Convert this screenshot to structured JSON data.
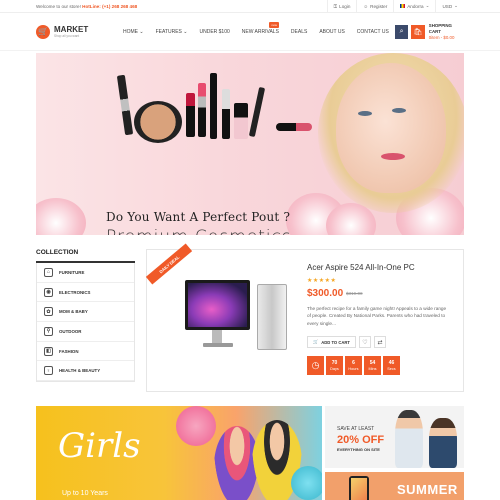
{
  "topbar": {
    "welcome": "Welcome to our store!",
    "hotline_label": "HotLine:",
    "hotline_number": "(+1) 268 268 468",
    "login": "Login",
    "register": "Register",
    "language": "Andorra",
    "currency": "USD"
  },
  "header": {
    "logo_name": "MARKET",
    "logo_tag": "Shop all you want",
    "nav": [
      {
        "label": "HOME",
        "dropdown": true
      },
      {
        "label": "FEATURES",
        "dropdown": true
      },
      {
        "label": "UNDER $100"
      },
      {
        "label": "NEW ARRIVALS",
        "badge": "new"
      },
      {
        "label": "DEALS"
      },
      {
        "label": "ABOUT US"
      },
      {
        "label": "CONTACT US"
      }
    ],
    "cart_title": "SHOPPING CART",
    "cart_summary": "0item - $0.00"
  },
  "banner": {
    "headline": "Do You Want A Perfect Pout ?",
    "subline": "Premium Cosmetics"
  },
  "collection": {
    "title": "COLLECTION",
    "items": [
      {
        "label": "FURNITURE",
        "icon": "chair-icon",
        "glyph": "⌂"
      },
      {
        "label": "ELECTRONICS",
        "icon": "speaker-icon",
        "glyph": "◉"
      },
      {
        "label": "MOM & BABY",
        "icon": "stroller-icon",
        "glyph": "✿"
      },
      {
        "label": "OUTDOOR",
        "icon": "bike-icon",
        "glyph": "⚲"
      },
      {
        "label": "FASHION",
        "icon": "bag-icon",
        "glyph": "◧"
      },
      {
        "label": "HEALTH & BEAUTY",
        "icon": "beauty-icon",
        "glyph": "♀"
      }
    ]
  },
  "deal": {
    "ribbon": "DAILY DEAL",
    "title": "Acer Aspire 524 All-In-One PC",
    "rating_stars": "★★★★★",
    "rating": 5,
    "price": "$300.00",
    "old_price": "$319.00",
    "description": "The perfect recipe for a family game night! Appeals to a wide range of people. Created By National Parks. Parents who had traveled to every single...",
    "add_to_cart": "ADD TO CART",
    "countdown": [
      {
        "value": "70",
        "unit": "Days"
      },
      {
        "value": "6",
        "unit": "Hours"
      },
      {
        "value": "54",
        "unit": "Mins"
      },
      {
        "value": "46",
        "unit": "Secs"
      }
    ]
  },
  "promos": {
    "girls_title": "Girls",
    "girls_sub": "Up to 10 Years",
    "save_label": "SAVE AT LEAST",
    "save_pct": "20% OFF",
    "save_scope": "EVERYTHING ON SITE",
    "summer": "SUMMER SALE"
  },
  "colors": {
    "accent": "#f05a28",
    "navy": "#3b4a6b"
  }
}
